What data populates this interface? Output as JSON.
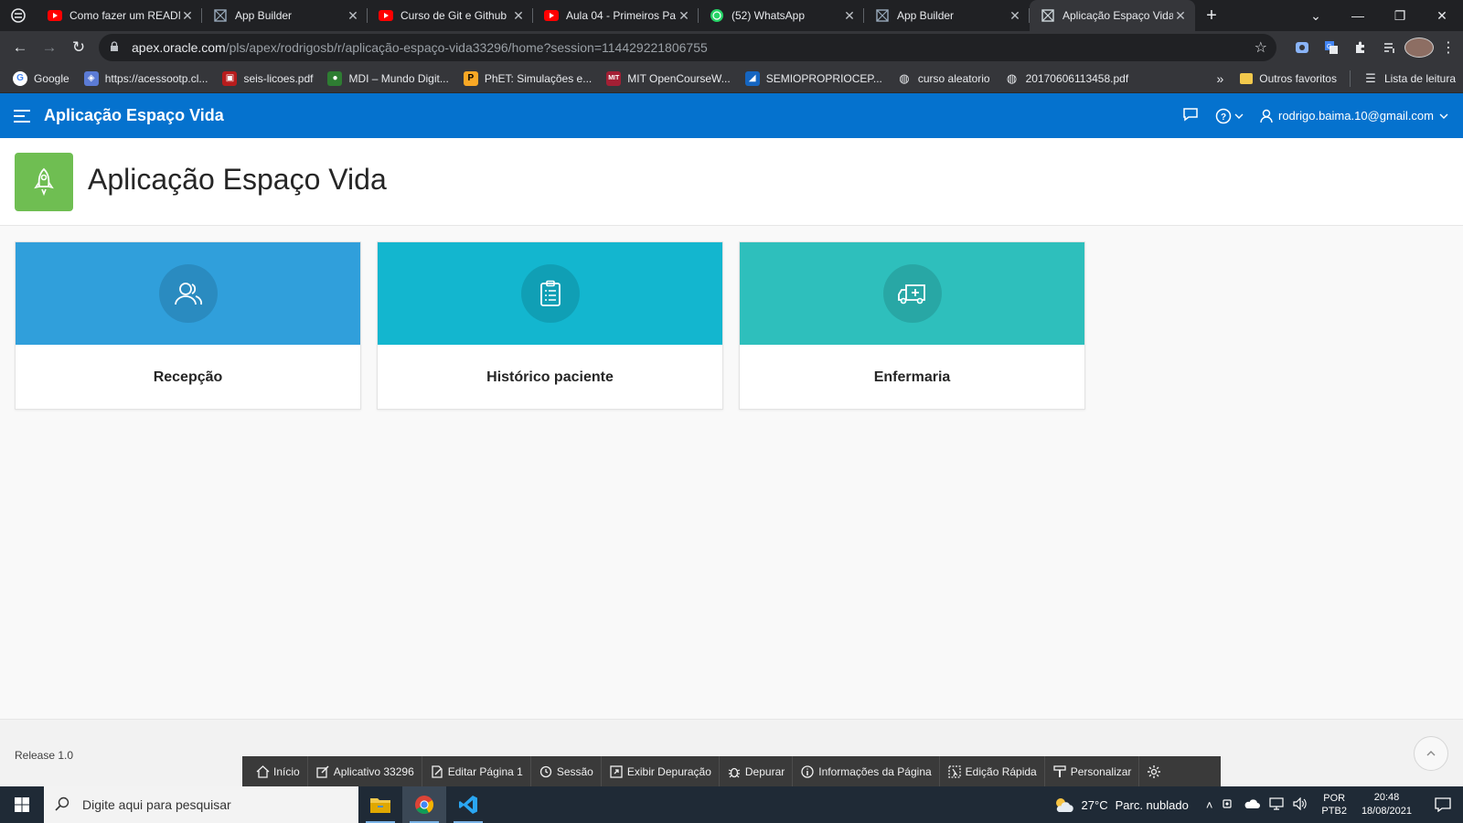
{
  "browser": {
    "tabs": [
      {
        "title": "Como fazer um READM",
        "favicon": "youtube-icon"
      },
      {
        "title": "App Builder",
        "favicon": "apex-icon"
      },
      {
        "title": "Curso de Git e Github",
        "favicon": "youtube-icon"
      },
      {
        "title": "Aula 04 - Primeiros Pa",
        "favicon": "youtube-icon"
      },
      {
        "title": "(52) WhatsApp",
        "favicon": "whatsapp-icon"
      },
      {
        "title": "App Builder",
        "favicon": "apex-icon"
      },
      {
        "title": "Aplicação Espaço Vida",
        "favicon": "apex-icon",
        "active": true
      }
    ],
    "url_host": "apex.oracle.com",
    "url_path": "/pls/apex/rodrigosb/r/aplicação-espaço-vida33296/home?session=114429221806755",
    "bookmarks": [
      {
        "label": "Google",
        "icon": "google-icon",
        "color": "#4285f4"
      },
      {
        "label": "https://acessootp.cl...",
        "icon": "shield-icon",
        "color": "#5b7bd5"
      },
      {
        "label": "seis-licoes.pdf",
        "icon": "pdf-icon",
        "color": "#b71c1c"
      },
      {
        "label": "MDI – Mundo Digit...",
        "icon": "mdi-icon",
        "color": "#2e7d32"
      },
      {
        "label": "PhET: Simulações e...",
        "icon": "phet-icon",
        "color": "#f9a825"
      },
      {
        "label": "MIT OpenCourseW...",
        "icon": "mit-icon",
        "color": "#a31f34"
      },
      {
        "label": "SEMIOPROPRIOCEP...",
        "icon": "doc-icon",
        "color": "#1565c0"
      },
      {
        "label": "curso aleatorio",
        "icon": "globe-icon",
        "color": "#9aa0a6"
      },
      {
        "label": "20170606113458.pdf",
        "icon": "globe-icon",
        "color": "#9aa0a6"
      }
    ],
    "other_bookmarks": "Outros favoritos",
    "reading_list": "Lista de leitura"
  },
  "header": {
    "app_name": "Aplicação Espaço Vida",
    "user_email": "rodrigo.baima.10@gmail.com",
    "color": "#0572ce"
  },
  "hero": {
    "title": "Aplicação Espaço Vida",
    "icon": "rocket-icon",
    "icon_color": "#6fbe52"
  },
  "cards": [
    {
      "label": "Recepção",
      "icon": "users-icon",
      "color": "#309fdb"
    },
    {
      "label": "Histórico paciente",
      "icon": "clipboard-icon",
      "color": "#13b6cf"
    },
    {
      "label": "Enfermaria",
      "icon": "ambulance-icon",
      "color": "#2ebfbc"
    }
  ],
  "footer": {
    "release": "Release 1.0"
  },
  "developer_toolbar": [
    {
      "label": "Início",
      "icon": "home-icon"
    },
    {
      "label": "Aplicativo 33296",
      "icon": "edit-icon"
    },
    {
      "label": "Editar Página 1",
      "icon": "edit-page-icon"
    },
    {
      "label": "Sessão",
      "icon": "session-icon"
    },
    {
      "label": "Exibir Depuração",
      "icon": "debug-view-icon"
    },
    {
      "label": "Depurar",
      "icon": "bug-icon"
    },
    {
      "label": "Informações da Página",
      "icon": "info-icon"
    },
    {
      "label": "Edição Rápida",
      "icon": "quick-edit-icon"
    },
    {
      "label": "Personalizar",
      "icon": "brush-icon"
    }
  ],
  "taskbar": {
    "search_placeholder": "Digite aqui para pesquisar",
    "temperature": "27°C",
    "weather": "Parc. nublado",
    "lang_1": "POR",
    "lang_2": "PTB2",
    "time": "20:48",
    "date": "18/08/2021"
  }
}
